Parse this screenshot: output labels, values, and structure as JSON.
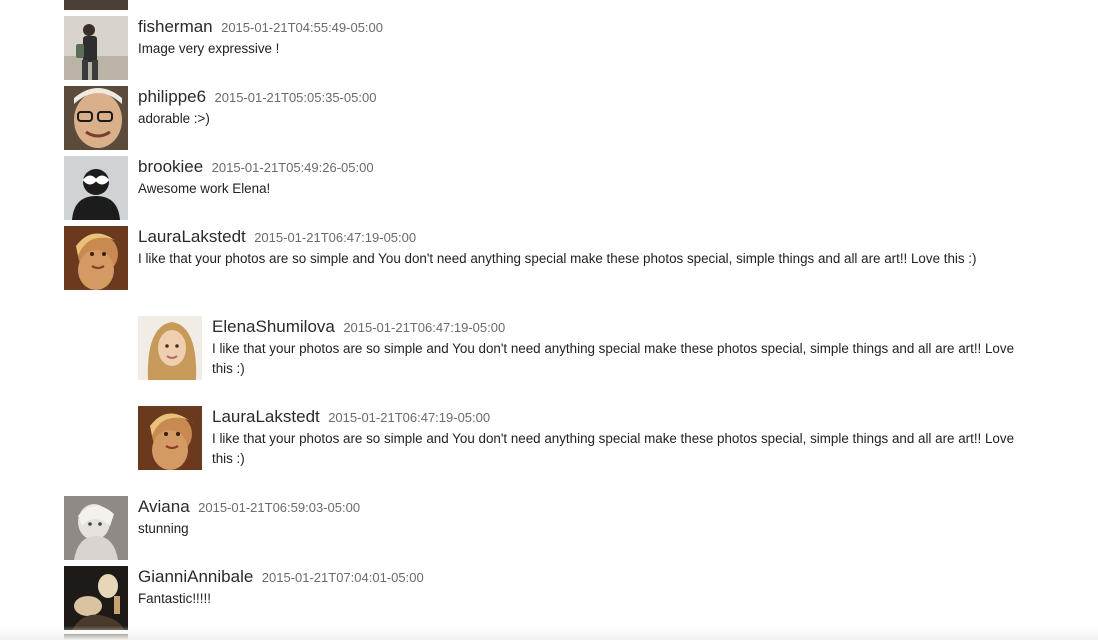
{
  "comments": [
    {
      "username": "fisherman",
      "timestamp": "2015-01-21T04:55:49-05:00",
      "text": "Image very expressive !",
      "avatar_icon": "person-photo-avatar"
    },
    {
      "username": "philippe6",
      "timestamp": "2015-01-21T05:05:35-05:00",
      "text": "adorable :>)",
      "avatar_icon": "person-photo-avatar"
    },
    {
      "username": "brookiee",
      "timestamp": "2015-01-21T05:49:26-05:00",
      "text": "Awesome work Elena!",
      "avatar_icon": "masked-silhouette-avatar"
    },
    {
      "username": "LauraLakstedt",
      "timestamp": "2015-01-21T06:47:19-05:00",
      "text": "I like that your photos are so simple and You don't need anything special make these photos special, simple things and all are art!! Love this :)",
      "avatar_icon": "person-photo-avatar"
    },
    {
      "username": "Aviana",
      "timestamp": "2015-01-21T06:59:03-05:00",
      "text": "stunning",
      "avatar_icon": "person-photo-avatar"
    },
    {
      "username": "GianniAnnibale",
      "timestamp": "2015-01-21T07:04:01-05:00",
      "text": "Fantastic!!!!!",
      "avatar_icon": "person-photo-avatar"
    }
  ],
  "replies": [
    {
      "username": "ElenaShumilova",
      "timestamp": "2015-01-21T06:47:19-05:00",
      "text": "I like that your photos are so simple and You don't need anything special make these photos special, simple things and all are art!! Love this :)",
      "avatar_icon": "person-photo-avatar"
    },
    {
      "username": "LauraLakstedt",
      "timestamp": "2015-01-21T06:47:19-05:00",
      "text": "I like that your photos are so simple and You don't need anything special make these photos special, simple things and all are art!! Love this :)",
      "avatar_icon": "person-photo-avatar"
    }
  ]
}
